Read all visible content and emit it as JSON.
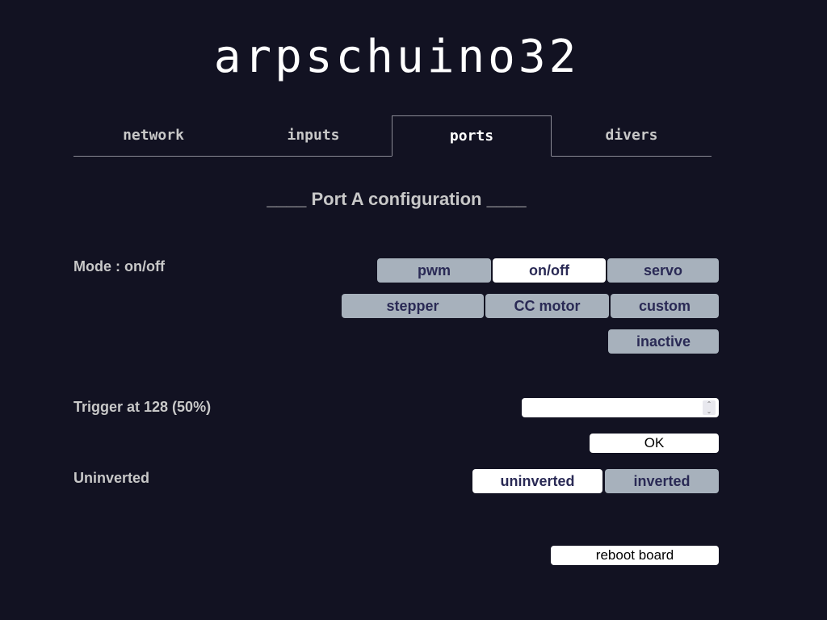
{
  "app": {
    "title": "arpschuino32"
  },
  "tabs": [
    {
      "label": "network",
      "active": false
    },
    {
      "label": "inputs",
      "active": false
    },
    {
      "label": "ports",
      "active": true
    },
    {
      "label": "divers",
      "active": false
    }
  ],
  "section": {
    "title": "____ Port A configuration ____"
  },
  "mode": {
    "label": "Mode : on/off",
    "selected": "on/off",
    "options": [
      "pwm",
      "on/off",
      "servo",
      "stepper",
      "CC motor",
      "custom",
      "inactive"
    ]
  },
  "trigger": {
    "label": "Trigger at 128 (50%)",
    "input_value": "",
    "spinner_up": "⌃",
    "spinner_down": "⌄",
    "ok_label": "OK"
  },
  "inversion": {
    "label": "Uninverted",
    "selected": "uninverted",
    "options": [
      "uninverted",
      "inverted"
    ]
  },
  "footer": {
    "reboot_label": "reboot board"
  }
}
